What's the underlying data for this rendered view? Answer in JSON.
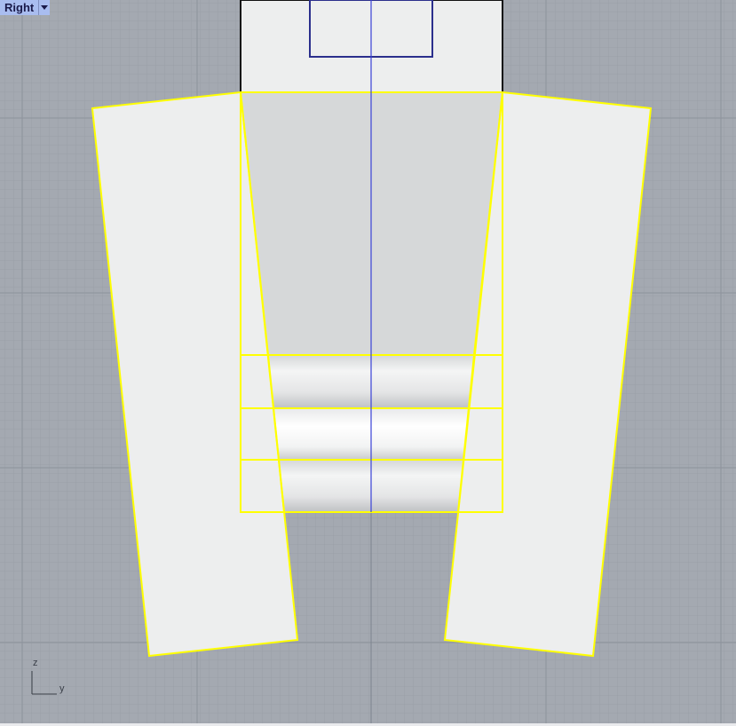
{
  "viewport": {
    "title": "Right",
    "menu_icon": "dropdown-triangle-icon",
    "axis_labels": {
      "vertical": "z",
      "horizontal": "y"
    }
  },
  "colors": {
    "background": "#a4a9b1",
    "grid_minor": "#9aa0a8",
    "grid_major": "#8d939c",
    "surface": "#edeeee",
    "surface_shadow": "#d6d8d9",
    "selection": "#ffff00",
    "inner_outline": "#2b2f8c",
    "center_line": "#3a42d8",
    "edge": "#111111"
  }
}
